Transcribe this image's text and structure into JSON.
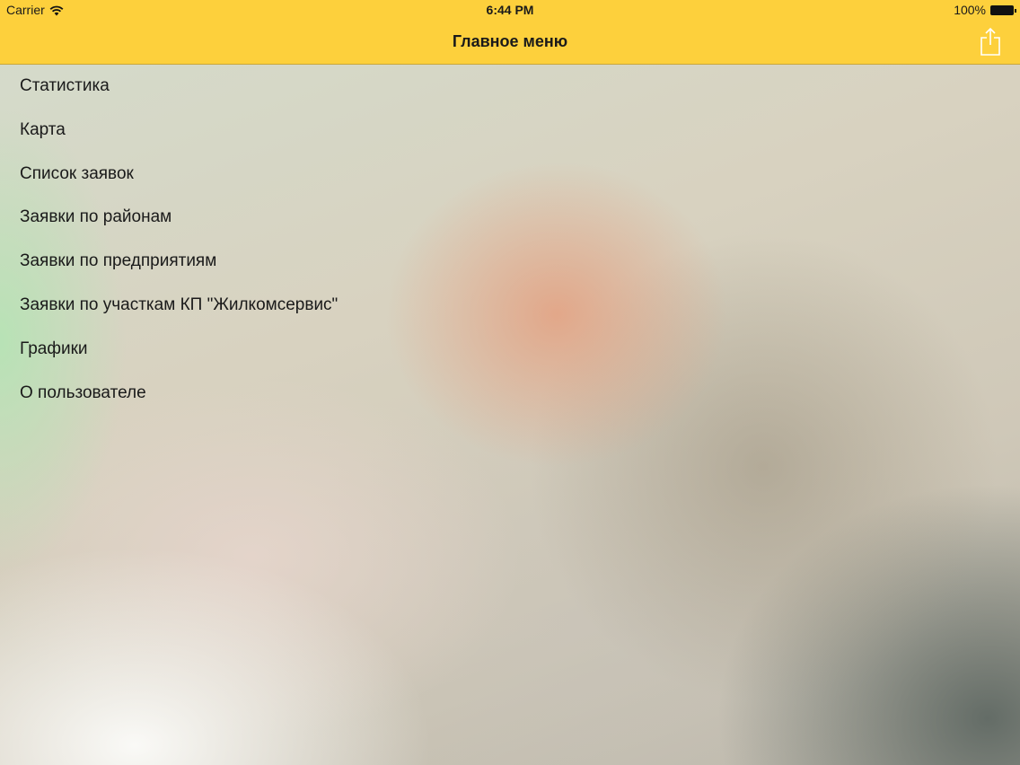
{
  "status_bar": {
    "carrier": "Carrier",
    "time": "6:44 PM",
    "battery": "100%"
  },
  "navbar": {
    "title": "Главное меню",
    "share_icon": "share-icon"
  },
  "menu": {
    "items": [
      {
        "label": "Статистика"
      },
      {
        "label": "Карта"
      },
      {
        "label": "Список заявок"
      },
      {
        "label": "Заявки по районам"
      },
      {
        "label": "Заявки по предприятиям"
      },
      {
        "label": "Заявки по участкам КП \"Жилкомсервис\""
      },
      {
        "label": "Графики"
      },
      {
        "label": "О пользователе"
      }
    ]
  },
  "colors": {
    "navbar_background": "#fdd03c",
    "text": "#1a1a1a"
  }
}
